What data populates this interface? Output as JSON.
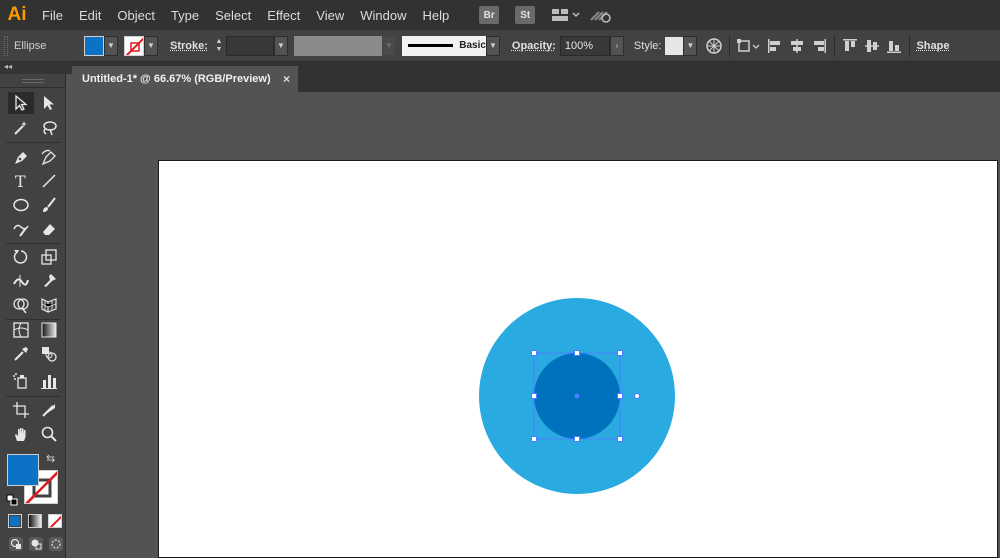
{
  "app": {
    "logo": "Ai"
  },
  "menu": [
    "File",
    "Edit",
    "Object",
    "Type",
    "Select",
    "Effect",
    "View",
    "Window",
    "Help"
  ],
  "menubar_badges": [
    "Br",
    "St"
  ],
  "menubar_icons": [
    "workspace-grid-icon",
    "gpu-performance-icon"
  ],
  "control": {
    "object_type": "Ellipse",
    "fill_color": "#0b72c6",
    "stroke_label": "Stroke:",
    "stroke_weight": "",
    "stroke_profile": "Basic",
    "opacity_label": "Opacity:",
    "opacity_value": "100%",
    "style_label": "Style:",
    "shape_label": "Shape"
  },
  "document": {
    "tab_title": "Untitled-1* @ 66.67% (RGB/Preview)",
    "close_glyph": "×"
  },
  "toolbar": {
    "fill_color": "#0b72c6",
    "tools": [
      "selection-tool-icon",
      "direct-selection-tool-icon",
      "magic-wand-tool-icon",
      "lasso-tool-icon",
      "pen-tool-icon",
      "curvature-tool-icon",
      "type-tool-icon",
      "line-segment-tool-icon",
      "ellipse-tool-icon",
      "paintbrush-tool-icon",
      "shaper-tool-icon",
      "eraser-tool-icon",
      "rotate-tool-icon",
      "scale-tool-icon",
      "width-tool-icon",
      "puppet-warp-tool-icon",
      "shape-builder-tool-icon",
      "perspective-grid-tool-icon",
      "mesh-tool-icon",
      "gradient-tool-icon",
      "eyedropper-tool-icon",
      "blend-tool-icon",
      "symbol-sprayer-tool-icon",
      "column-graph-tool-icon",
      "artboard-tool-icon",
      "slice-tool-icon",
      "hand-tool-icon",
      "zoom-tool-icon"
    ]
  },
  "artwork": {
    "outer_circle_color": "#29abe2",
    "inner_circle_color": "#0071bc",
    "selection_color": "#4a7dff"
  }
}
